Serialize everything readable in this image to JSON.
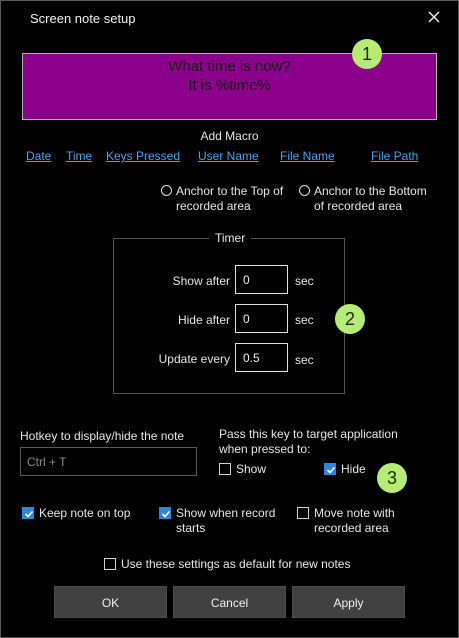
{
  "window": {
    "title": "Screen note setup"
  },
  "preview": {
    "line1": "What time is now?",
    "line2": "It is %time%"
  },
  "badges": {
    "b1": "1",
    "b2": "2",
    "b3": "3"
  },
  "macro": {
    "title": "Add Macro",
    "links": [
      "Date",
      "Time",
      "Keys Pressed",
      "User Name",
      "File Name",
      "File Path"
    ]
  },
  "anchor": {
    "top_line1": "Anchor to the Top of",
    "top_line2": "recorded area",
    "bottom_line1": "Anchor to the Bottom",
    "bottom_line2": "of recorded area"
  },
  "timer": {
    "legend": "Timer",
    "show_after_label": "Show after",
    "show_after_value": "0",
    "hide_after_label": "Hide after",
    "hide_after_value": "0",
    "update_every_label": "Update every",
    "update_every_value": "0.5",
    "unit": "sec"
  },
  "hotkey": {
    "label": "Hotkey to display/hide the note",
    "placeholder": "Ctrl + T"
  },
  "pass": {
    "line1": "Pass this key to target application",
    "line2": "when pressed to:",
    "show_label": "Show",
    "show_checked": false,
    "hide_label": "Hide",
    "hide_checked": true
  },
  "options": {
    "keep_on_top": "Keep note on top",
    "show_when_line1": "Show when record",
    "show_when_line2": "starts",
    "move_note_line1": "Move note with",
    "move_note_line2": "recorded area",
    "use_default": "Use these settings as default for new notes"
  },
  "buttons": {
    "ok": "OK",
    "cancel": "Cancel",
    "apply": "Apply"
  },
  "colors": {
    "preview_bg": "#8a008a",
    "badge": "#b6ec75",
    "link": "#4aa2e8",
    "check": "#2f86d6"
  }
}
